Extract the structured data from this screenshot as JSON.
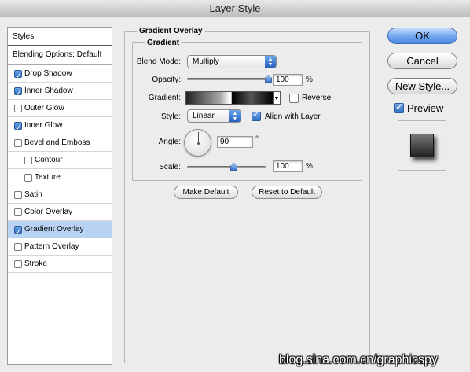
{
  "window": {
    "title": "Layer Style"
  },
  "sidebar": {
    "header": "Styles",
    "blending_options": "Blending Options: Default",
    "items": [
      {
        "label": "Drop Shadow",
        "checked": true,
        "sub": false,
        "selected": false
      },
      {
        "label": "Inner Shadow",
        "checked": true,
        "sub": false,
        "selected": false
      },
      {
        "label": "Outer Glow",
        "checked": false,
        "sub": false,
        "selected": false
      },
      {
        "label": "Inner Glow",
        "checked": true,
        "sub": false,
        "selected": false
      },
      {
        "label": "Bevel and Emboss",
        "checked": false,
        "sub": false,
        "selected": false
      },
      {
        "label": "Contour",
        "checked": false,
        "sub": true,
        "selected": false
      },
      {
        "label": "Texture",
        "checked": false,
        "sub": true,
        "selected": false
      },
      {
        "label": "Satin",
        "checked": false,
        "sub": false,
        "selected": false
      },
      {
        "label": "Color Overlay",
        "checked": false,
        "sub": false,
        "selected": false
      },
      {
        "label": "Gradient Overlay",
        "checked": true,
        "sub": false,
        "selected": true
      },
      {
        "label": "Pattern Overlay",
        "checked": false,
        "sub": false,
        "selected": false
      },
      {
        "label": "Stroke",
        "checked": false,
        "sub": false,
        "selected": false
      }
    ]
  },
  "panel": {
    "section_title": "Gradient Overlay",
    "group_title": "Gradient",
    "blend_mode_label": "Blend Mode:",
    "blend_mode_value": "Multiply",
    "opacity_label": "Opacity:",
    "opacity_value": "100",
    "opacity_level": 1.0,
    "percent": "%",
    "gradient_label": "Gradient:",
    "reverse_label": "Reverse",
    "reverse_checked": false,
    "style_label": "Style:",
    "style_value": "Linear",
    "align_label": "Align with Layer",
    "align_checked": true,
    "angle_label": "Angle:",
    "angle_value": "90",
    "degree": "°",
    "scale_label": "Scale:",
    "scale_value": "100",
    "scale_level": 0.6,
    "make_default": "Make Default",
    "reset_default": "Reset to Default"
  },
  "buttons": {
    "ok": "OK",
    "cancel": "Cancel",
    "new_style": "New Style...",
    "preview_label": "Preview",
    "preview_checked": true
  },
  "watermark": "blog.sina.com.cn/graphicspy"
}
